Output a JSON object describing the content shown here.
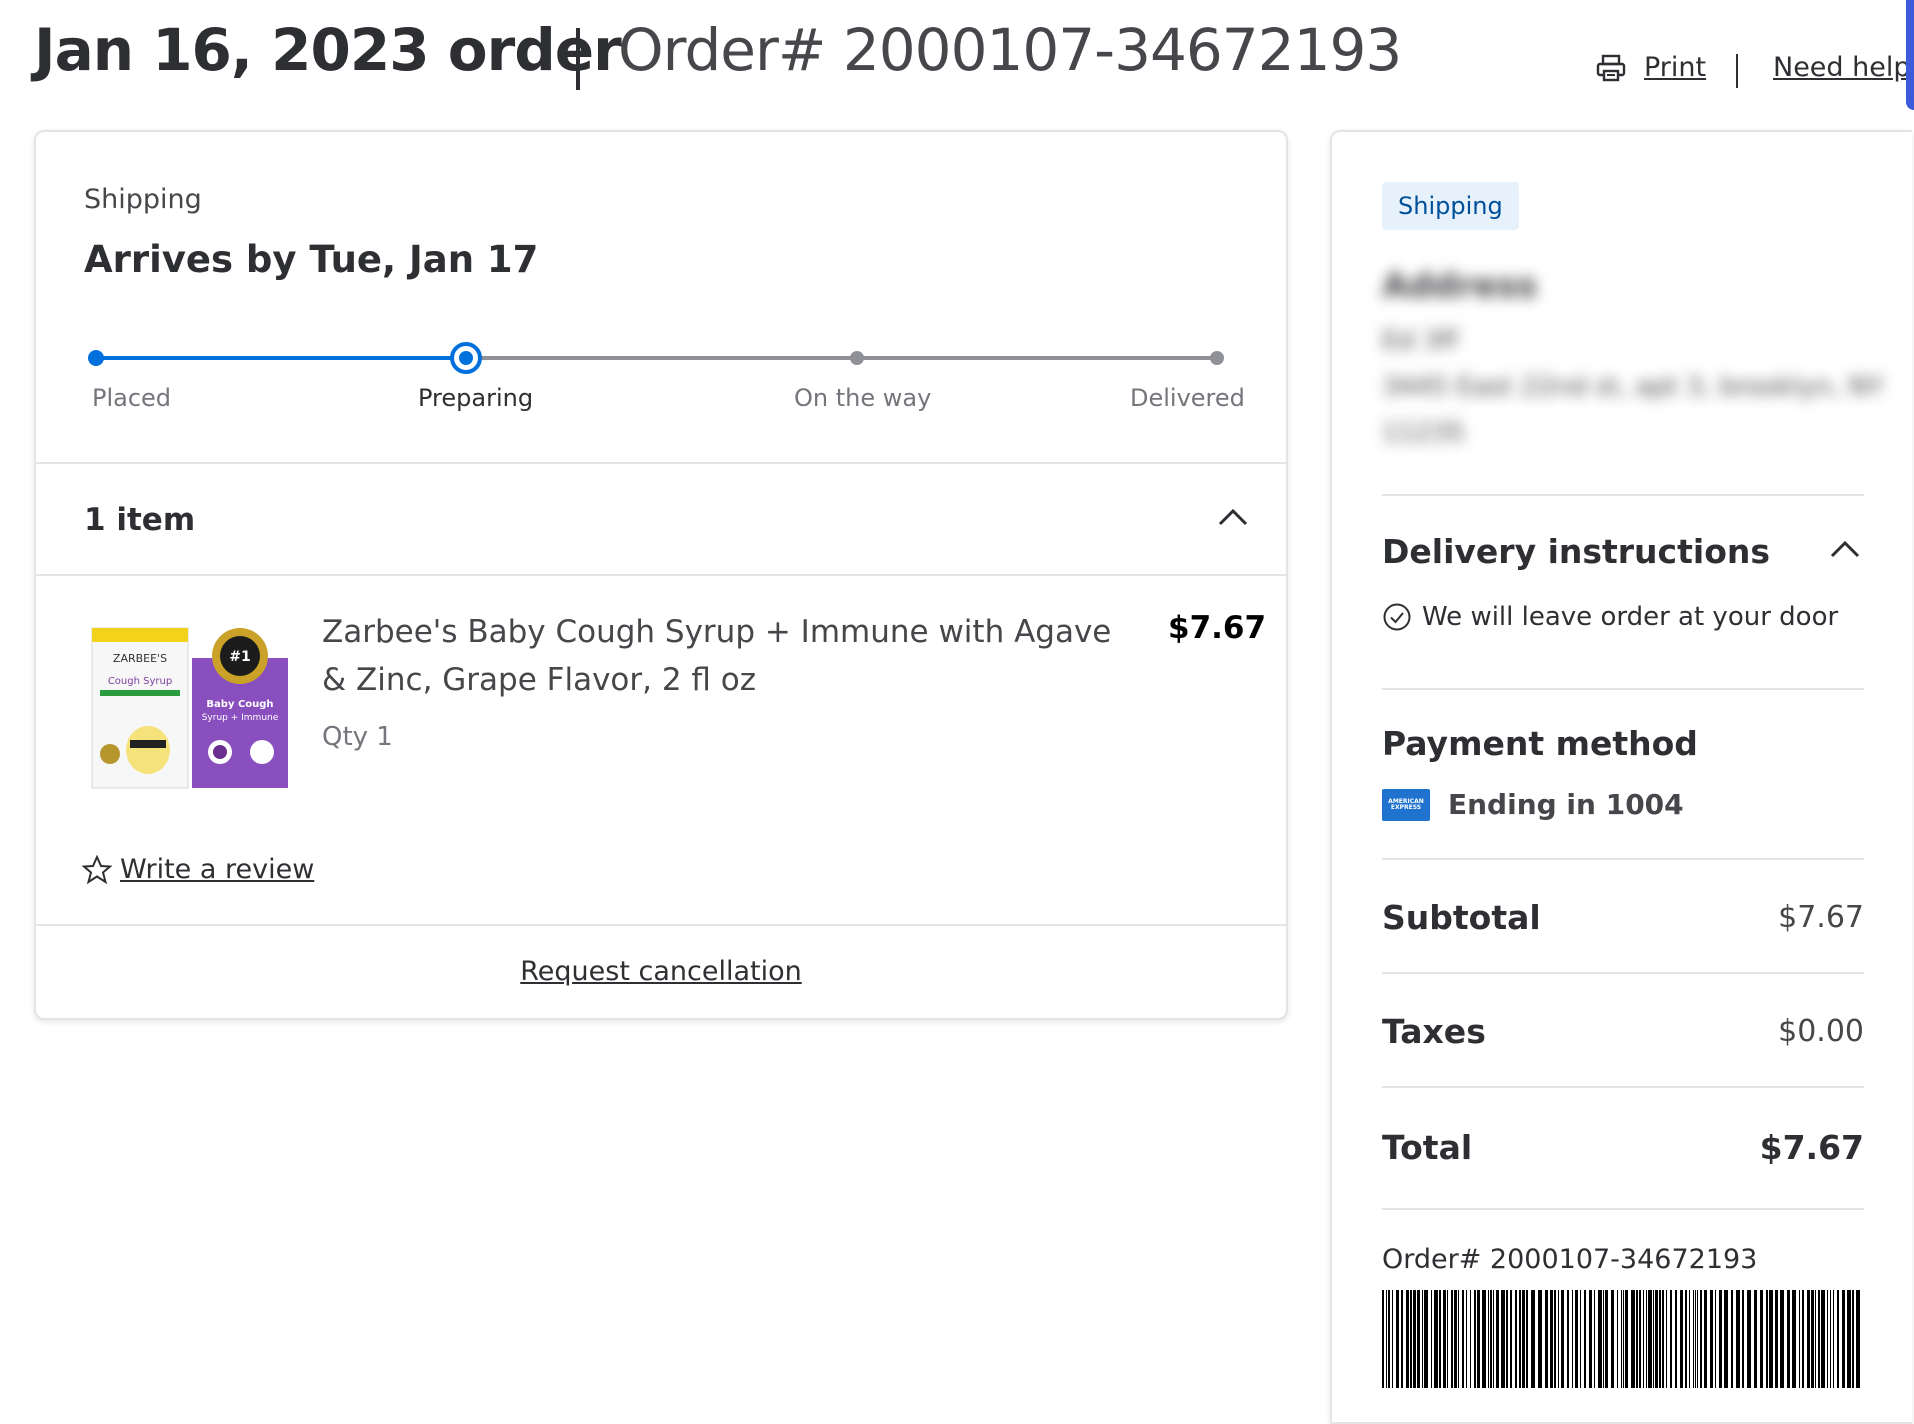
{
  "header": {
    "order_date": "Jan 16, 2023 order",
    "order_number": "Order# 2000107-34672193",
    "print_label": "Print",
    "help_label": "Need help?"
  },
  "shipment": {
    "type_label": "Shipping",
    "arrival": "Arrives by Tue, Jan 17",
    "steps": [
      "Placed",
      "Preparing",
      "On the way",
      "Delivered"
    ],
    "current_step": "Preparing",
    "items_count": "1 item",
    "item": {
      "name": "Zarbee's Baby Cough Syrup + Immune with Agave & Zinc, Grape Flavor, 2 fl oz",
      "qty": "Qty 1",
      "price": "$7.67",
      "image_alt": "Zarbee's Baby Cough Syrup box"
    },
    "review_label": "Write a review",
    "cancel_label": "Request cancellation"
  },
  "summary": {
    "badge": "Shipping",
    "address_title": "Address",
    "address_lines": [
      "Ed 3ff",
      "3445 East 22nd st, apt 3, brooklyn, NY",
      "11235"
    ],
    "delivery_instructions_title": "Delivery instructions",
    "delivery_instruction": "We will leave order at your door",
    "payment_title": "Payment method",
    "payment_card": "Ending in 1004",
    "card_brand": "AMERICAN EXPRESS",
    "subtotal_label": "Subtotal",
    "subtotal": "$7.67",
    "taxes_label": "Taxes",
    "taxes": "$0.00",
    "total_label": "Total",
    "total": "$7.67",
    "order_ref": "Order# 2000107-34672193"
  },
  "colors": {
    "accent": "#0071dc",
    "text": "#2e2f32",
    "muted": "#74767c",
    "badge_bg": "#e6f1fc"
  },
  "icons": [
    "printer-icon",
    "chevron-up-icon",
    "star-outline-icon",
    "check-circle-icon",
    "amex-card-icon",
    "barcode"
  ]
}
